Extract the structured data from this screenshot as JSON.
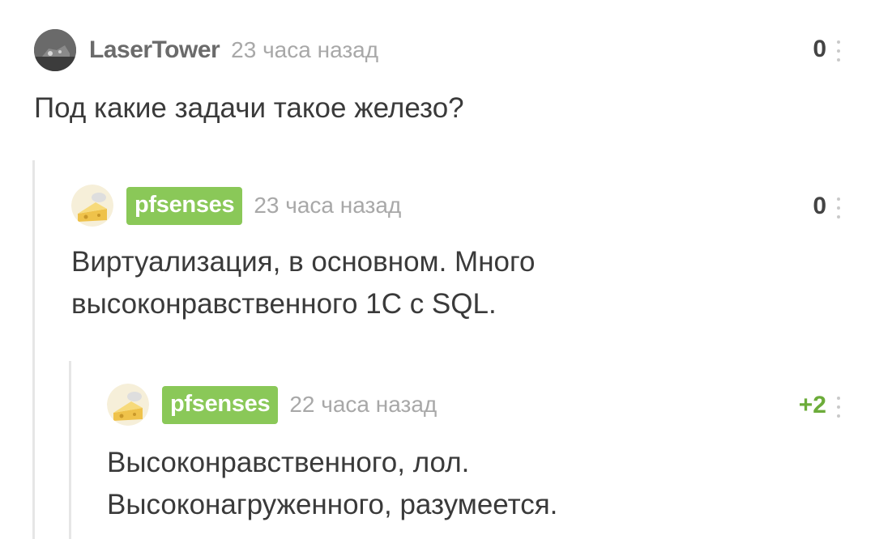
{
  "comments": [
    {
      "author": "LaserTower",
      "time": "23 часа назад",
      "rating": "0",
      "text": "Под какие задачи такое железо?"
    },
    {
      "author": "pfsenses",
      "time": "23 часа назад",
      "rating": "0",
      "line1": "Виртуализация, в основном. Много",
      "line2": "высоконравственного 1С с SQL."
    },
    {
      "author": "pfsenses",
      "time": "22 часа назад",
      "rating": "+2",
      "line1": "Высоконравственного, лол.",
      "line2": "Высоконагруженного, разумеется."
    }
  ],
  "colors": {
    "badge": "#8ac858",
    "positive_rating": "#6cac3a",
    "time": "#a8a8a8",
    "text": "#3a3a3a"
  }
}
